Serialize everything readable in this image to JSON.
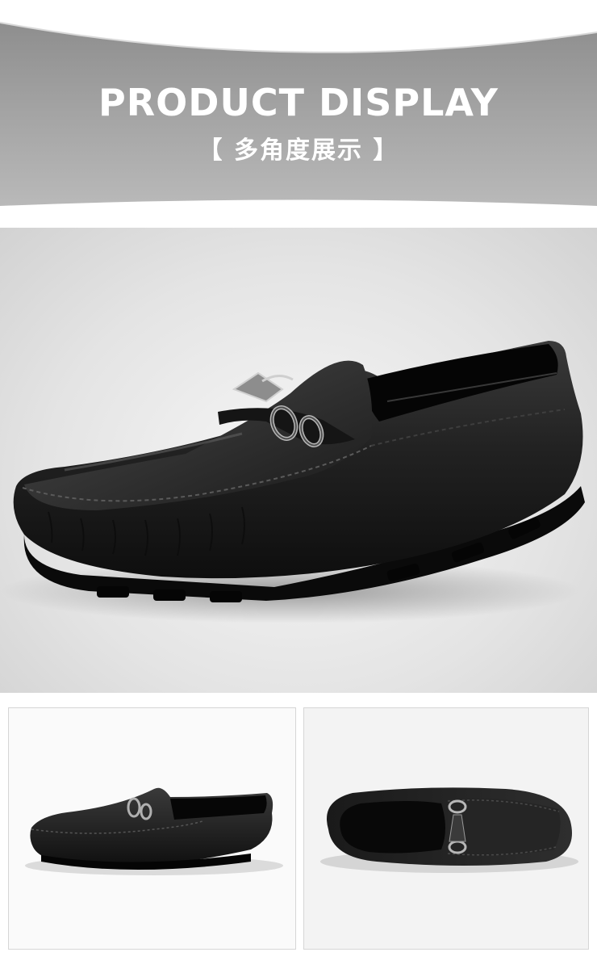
{
  "banner": {
    "title": "PRODUCT DISPLAY",
    "subtitle": "【 多角度展示 】"
  },
  "colors": {
    "banner_gray": "#9f9f9f",
    "leather": "#1c1c1c",
    "hero_bg": "#e6e6e6"
  },
  "images": {
    "hero": "black-leather-loafer-side-angle",
    "thumb_left": "black-leather-loafer-side-view",
    "thumb_right": "black-leather-loafer-top-view"
  }
}
